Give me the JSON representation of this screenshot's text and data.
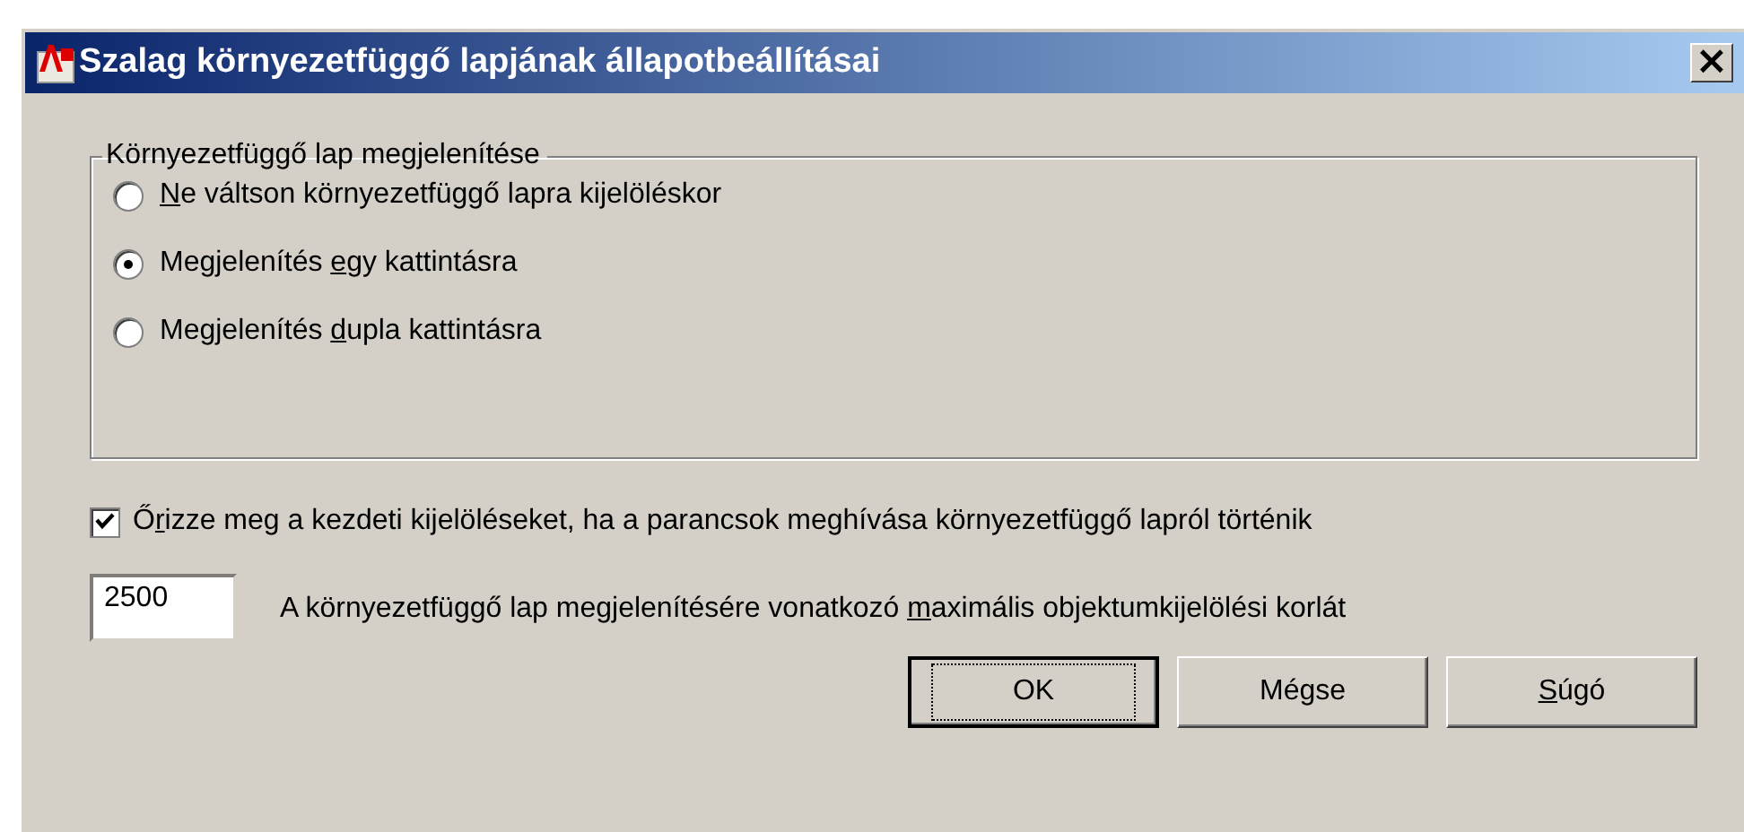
{
  "window": {
    "title": "Szalag környezetfüggő lapjának állapotbeállításai",
    "close": "×"
  },
  "group": {
    "title": "Környezetfüggő lap megjelenítése",
    "options": [
      {
        "label": {
          "key": "N",
          "post": "e váltson környezetfüggő lapra kijelöléskor"
        },
        "selected": false
      },
      {
        "label": {
          "pre": "Megjelenítés ",
          "key": "e",
          "post": "gy kattintásra"
        },
        "selected": true
      },
      {
        "label": {
          "pre": "Megjelenítés ",
          "key": "d",
          "post": "upla kattintásra"
        },
        "selected": false
      }
    ]
  },
  "keep_selection": {
    "label": {
      "pre": "Ő",
      "key": "r",
      "post": "izze meg a kezdeti kijelöléseket, ha a parancsok meghívása környezetfüggő lapról történik"
    },
    "checked": true
  },
  "limit": {
    "value": "2500",
    "label": {
      "pre": "A környezetfüggő lap megjelenítésére vonatkozó ",
      "key": "m",
      "post": "aximális objektumkijelölési korlát"
    }
  },
  "buttons": [
    {
      "label": "OK",
      "default": true
    },
    {
      "label": "Mégse",
      "default": false
    },
    {
      "label": {
        "key": "S",
        "post": "úgó"
      },
      "default": false
    }
  ]
}
